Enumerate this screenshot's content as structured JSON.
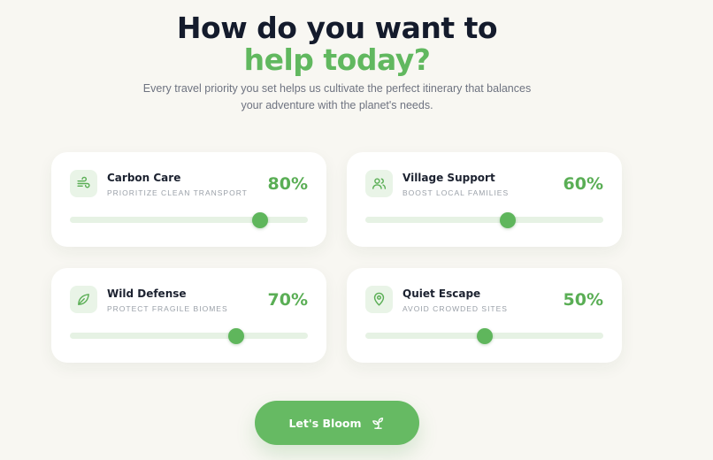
{
  "hero": {
    "title_line1": "How do you want to",
    "title_line2": "help today?",
    "subtitle": "Every travel priority you set helps us cultivate the perfect itinerary that balances your adventure with the planet's needs."
  },
  "priorities": [
    {
      "title": "Carbon Care",
      "subtitle": "PRIORITIZE CLEAN TRANSPORT",
      "percent_label": "80%",
      "value": 80,
      "icon": "wind-icon"
    },
    {
      "title": "Village Support",
      "subtitle": "BOOST LOCAL FAMILIES",
      "percent_label": "60%",
      "value": 60,
      "icon": "users-icon"
    },
    {
      "title": "Wild Defense",
      "subtitle": "PROTECT FRAGILE BIOMES",
      "percent_label": "70%",
      "value": 70,
      "icon": "leaf-icon"
    },
    {
      "title": "Quiet Escape",
      "subtitle": "AVOID CROWDED SITES",
      "percent_label": "50%",
      "value": 50,
      "icon": "map-pin-icon"
    }
  ],
  "cta": {
    "label": "Let's Bloom",
    "icon": "sprout-icon"
  },
  "colors": {
    "background": "#f8f7f2",
    "heading": "#141b2c",
    "accent": "#61b85f",
    "track": "#e6f2e4"
  }
}
